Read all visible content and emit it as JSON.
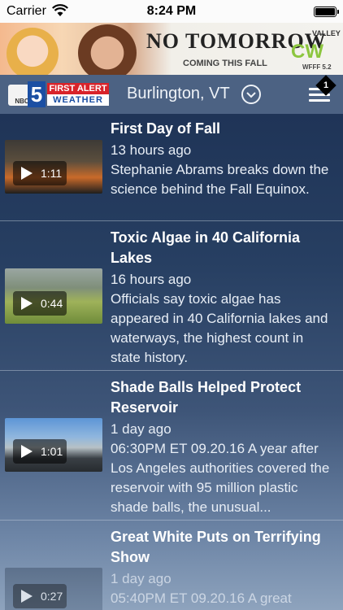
{
  "status_bar": {
    "carrier": "Carrier",
    "time": "8:24 PM",
    "wifi_icon": "wifi-icon",
    "battery_icon": "battery-icon"
  },
  "ad": {
    "title": "NO TOMORROW",
    "subtitle": "COMING THIS FALL",
    "network": "CW",
    "network_top": "VALLEY",
    "call_sign": "WFFF 5.2"
  },
  "header": {
    "logo_network": "NBC",
    "logo_number": "5",
    "logo_line1": "FIRST ALERT",
    "logo_line2": "WEATHER",
    "location": "Burlington, VT",
    "menu_badge": "1",
    "colors": {
      "bar": "#4c6283",
      "logo_red": "#d8232a",
      "logo_blue": "#1b4fa3"
    }
  },
  "feed": {
    "items": [
      {
        "title": "First Day of Fall",
        "time_ago": "13 hours ago",
        "description": "Stephanie Abrams breaks down the science behind the Fall Equinox.",
        "duration": "1:11"
      },
      {
        "title": "Toxic Algae in 40 California Lakes",
        "time_ago": "16 hours ago",
        "description": "Officials say toxic algae has appeared in 40 California lakes and waterways, the highest count in state history.",
        "duration": "0:44"
      },
      {
        "title": "Shade Balls Helped Protect Reservoir",
        "time_ago": "1 day ago",
        "description": "06:30PM ET 09.20.16 A year after Los Angeles authorities covered the reservoir with 95 million plastic shade balls, the unusual...",
        "duration": "1:01"
      },
      {
        "title": "Great White Puts on Terrifying Show",
        "time_ago": "1 day ago",
        "description": "05:40PM ET 09.20.16 A great",
        "duration": "0:27"
      }
    ]
  }
}
